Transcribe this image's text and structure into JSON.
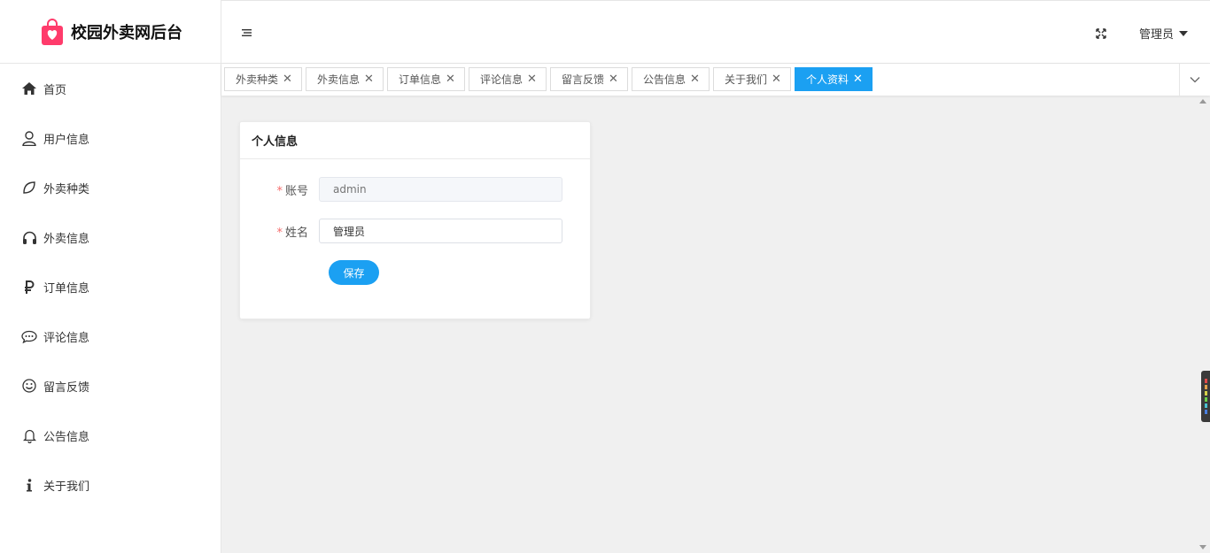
{
  "app": {
    "title": "校园外卖网后台"
  },
  "sidebar": {
    "items": [
      {
        "label": "首页",
        "icon": "home-icon"
      },
      {
        "label": "用户信息",
        "icon": "user-icon"
      },
      {
        "label": "外卖种类",
        "icon": "leaf-icon"
      },
      {
        "label": "外卖信息",
        "icon": "headphones-icon"
      },
      {
        "label": "订单信息",
        "icon": "ruble-icon"
      },
      {
        "label": "评论信息",
        "icon": "chat-icon"
      },
      {
        "label": "留言反馈",
        "icon": "smile-icon"
      },
      {
        "label": "公告信息",
        "icon": "bell-icon"
      },
      {
        "label": "关于我们",
        "icon": "info-icon"
      }
    ]
  },
  "header": {
    "user": "管理员"
  },
  "tabs": [
    {
      "label": "外卖种类",
      "active": false
    },
    {
      "label": "外卖信息",
      "active": false
    },
    {
      "label": "订单信息",
      "active": false
    },
    {
      "label": "评论信息",
      "active": false
    },
    {
      "label": "留言反馈",
      "active": false
    },
    {
      "label": "公告信息",
      "active": false
    },
    {
      "label": "关于我们",
      "active": false
    },
    {
      "label": "个人资料",
      "active": true
    }
  ],
  "card": {
    "title": "个人信息",
    "account_label": "账号",
    "account_placeholder": "admin",
    "name_label": "姓名",
    "name_value": "管理员",
    "save_label": "保存"
  },
  "colors": {
    "accent": "#1ba0f2",
    "required": "#f56c6c"
  }
}
